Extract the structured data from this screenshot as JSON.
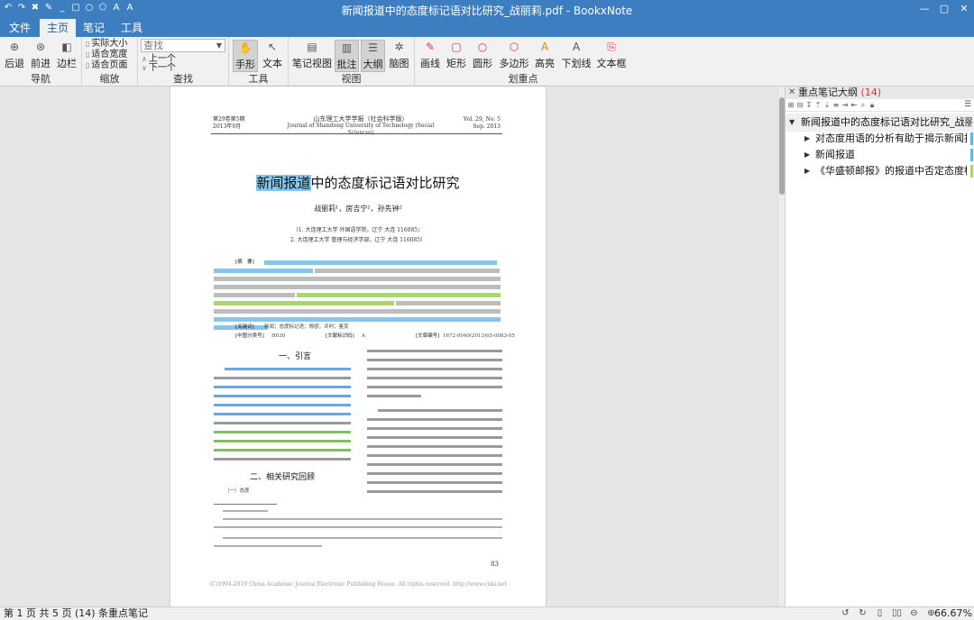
{
  "window": {
    "title": "新闻报道中的态度标记语对比研究_战丽莉.pdf - BookxNote"
  },
  "menu_tabs": [
    "文件",
    "主页",
    "笔记",
    "工具"
  ],
  "active_tab": "主页",
  "ribbon": {
    "nav": {
      "back": "后退",
      "forward": "前进",
      "edge": "边栏",
      "label": "导航"
    },
    "zoom": {
      "actual": "实际大小",
      "fit_width": "适合宽度",
      "fit_page": "适合页面",
      "label": "缩放"
    },
    "find": {
      "placeholder": "查找",
      "up": "上一个",
      "down": "下一个",
      "label": "查找"
    },
    "tools": {
      "hand": "手形",
      "text": "文本",
      "label": "工具"
    },
    "view": {
      "notes_view": "笔记视图",
      "annotate": "批注",
      "outline": "大纲",
      "mindmap": "脑图",
      "label": "视图"
    },
    "highlight": {
      "line": "画线",
      "rect": "矩形",
      "circle": "圆形",
      "polygon": "多边形",
      "hilite": "高亮",
      "underline": "下划线",
      "textbox": "文本框",
      "label": "划重点"
    }
  },
  "document": {
    "header_left": [
      "第29卷第5期",
      "2013年9月"
    ],
    "header_journal": "山东理工大学学报（社会科学版）",
    "header_journal_en": "Journal of Shandong University of Technology (Social Sciences)",
    "header_right": [
      "Vol. 29, No. 5",
      "Sep. 2013"
    ],
    "title_highlight": "新闻报道",
    "title_rest": "中的态度标记语对比研究",
    "authors": "战丽莉¹，房吉宁²，孙先钟²",
    "affiliations": [
      "（1. 大连理工大学 外国语学院，辽宁 大连 116085；",
      "2. 大连理工大学 管理与经济学部，辽宁 大连 116085）"
    ],
    "abstract_label": "[摘　要]",
    "keywords_label": "[关键词]",
    "keywords": "新闻；态度标记语；情感；评判；鉴赏",
    "clc_label": "[中图分类号]",
    "clc": "H030",
    "doc_code_label": "[文献标识码]",
    "doc_code": "A",
    "article_no_label": "[文章编号]",
    "article_no": "1672-0040(2013)05-0083-05",
    "section1": "一、引言",
    "section2": "二、相关研究回顾",
    "subsection": "（一）态度",
    "page_number": "83",
    "footer": "(C)1994-2019 China Academic Journal Electronic Publishing House. All rights reserved.    http://www.cnki.net"
  },
  "outline_panel": {
    "title": "重点笔记大纲",
    "count": "(14)",
    "root": "新闻报道中的态度标记语对比研究_战丽莉",
    "items": [
      {
        "label": "对态度用语的分析有助于揭示新闻报道",
        "color": "#5fb6e8"
      },
      {
        "label": "新闻报道",
        "color": "#5fb6e8"
      },
      {
        "label": "《华盛顿邮报》的报道中否定态度标记语",
        "color": "#a8d86a"
      }
    ]
  },
  "status": {
    "text": "第 1 页 共 5 页   (14) 条重点笔记",
    "zoom": "66.67%"
  }
}
